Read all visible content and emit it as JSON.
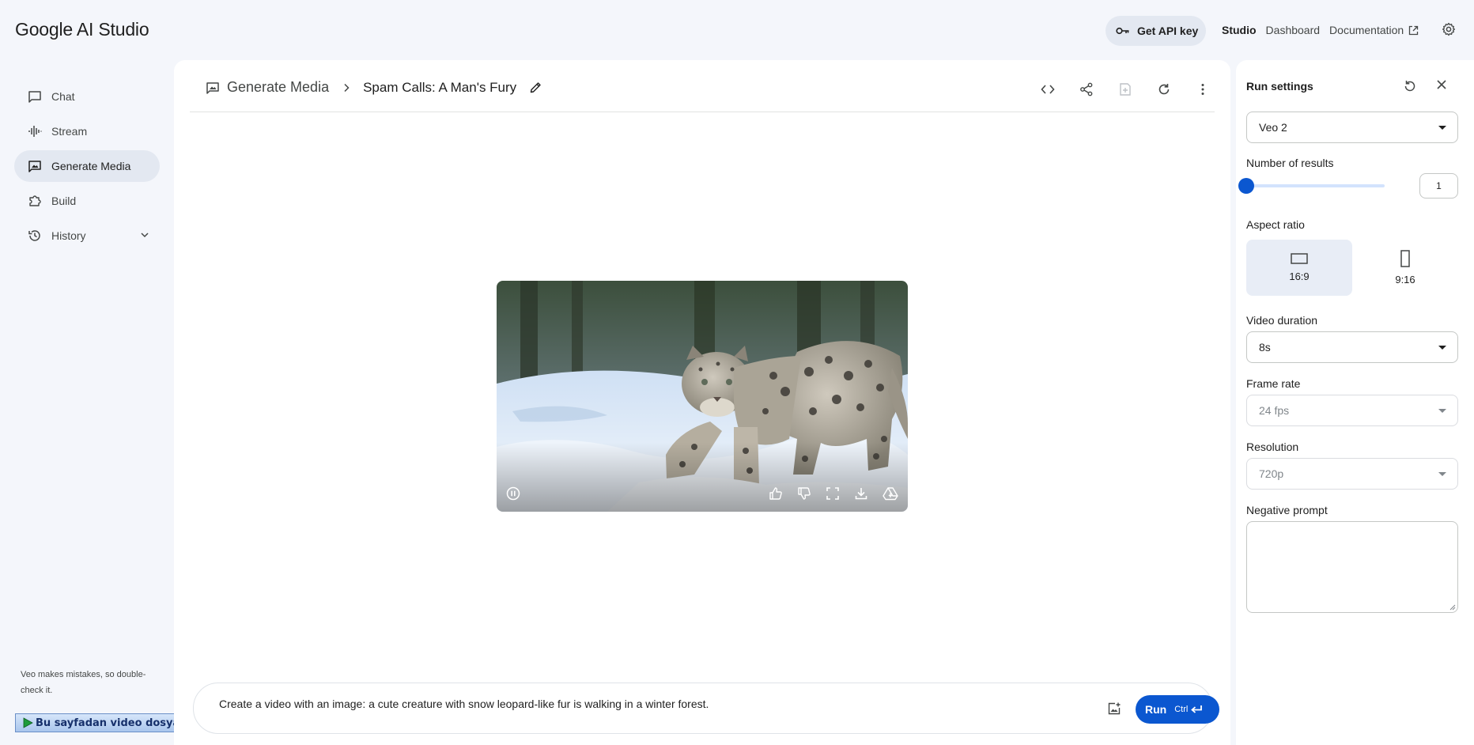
{
  "header": {
    "logo": "Google AI Studio",
    "api_key_label": "Get API key",
    "links": [
      "Studio",
      "Dashboard",
      "Documentation"
    ],
    "active_link": "Studio"
  },
  "sidebar": {
    "items": [
      {
        "label": "Chat",
        "icon": "chat-icon"
      },
      {
        "label": "Stream",
        "icon": "stream-icon"
      },
      {
        "label": "Generate Media",
        "icon": "media-icon",
        "active": true
      },
      {
        "label": "Build",
        "icon": "build-icon"
      },
      {
        "label": "History",
        "icon": "history-icon"
      }
    ],
    "disclaimer": "Veo makes mistakes, so double-check it."
  },
  "download_bar": {
    "label": "Bu sayfadan video dosyasını indir",
    "help": "?",
    "close": "X"
  },
  "main": {
    "breadcrumb_root": "Generate Media",
    "title": "Spam Calls: A Man's Fury",
    "prompt": "Create a video with an image: a cute creature with snow leopard-like fur is walking in a winter forest.",
    "run_label": "Run",
    "run_shortcut": "Ctrl"
  },
  "run_settings": {
    "title": "Run settings",
    "model": "Veo 2",
    "num_results_label": "Number of results",
    "num_results": "1",
    "num_results_fraction": 0.0,
    "aspect_label": "Aspect ratio",
    "aspect_options": [
      "16:9",
      "9:16"
    ],
    "aspect_selected": "16:9",
    "duration_label": "Video duration",
    "duration": "8s",
    "frame_rate_label": "Frame rate",
    "frame_rate": "24 fps",
    "resolution_label": "Resolution",
    "resolution": "720p",
    "negative_label": "Negative prompt",
    "negative_value": ""
  },
  "colors": {
    "accent": "#0b57d0",
    "page_bg": "#f4f6fb",
    "active_nav": "#e3e8f1"
  }
}
